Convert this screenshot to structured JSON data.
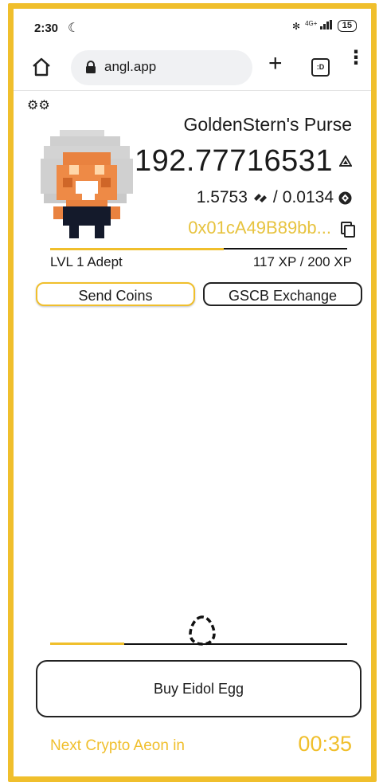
{
  "status_bar": {
    "time": "2:30",
    "moon_glyph": "☾",
    "bluetooth_glyph": "✻",
    "signal_label": "4G+",
    "battery": "15"
  },
  "browser": {
    "url": "angl.app",
    "plus_glyph": "+",
    "tab_label": ":D",
    "menu_glyph": "⋮"
  },
  "profile": {
    "settings_glyph": "⚙⚙",
    "purse_title": "GoldenStern's Purse",
    "main_balance": "192.77716531",
    "main_token_icon": "angl-token-icon",
    "secondary_balance": "1.5753",
    "secondary_separator": "/",
    "tertiary_balance": "0.0134",
    "wallet_address": "0x01cA49B89bb...",
    "level_label": "LVL 1 Adept",
    "xp_text": "117 XP / 200 XP",
    "xp_progress": 0.585
  },
  "actions": {
    "send_label": "Send Coins",
    "exchange_label": "GSCB Exchange"
  },
  "egg": {
    "progress": 0.25,
    "buy_label": "Buy Eidol Egg"
  },
  "aeon": {
    "label": "Next Crypto Aeon in",
    "timer": "00:35"
  },
  "colors": {
    "accent": "#f0bf2c",
    "address": "#e7c33f",
    "ink": "#1a1a1a"
  }
}
